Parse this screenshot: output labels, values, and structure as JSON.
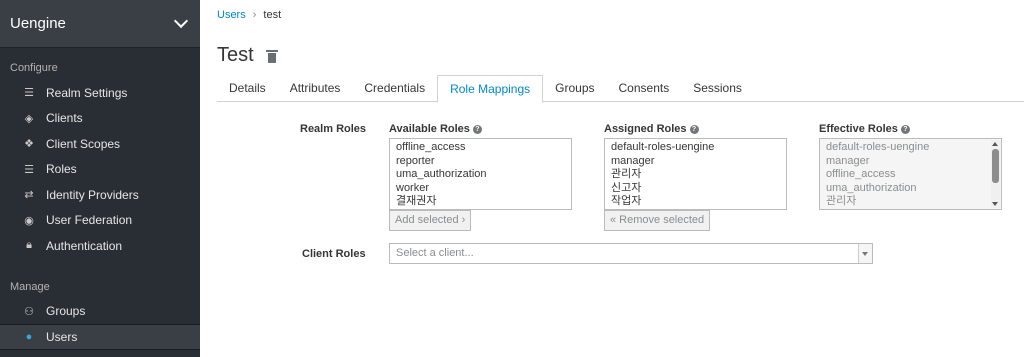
{
  "sidebar": {
    "realm": "Uengine",
    "configure_title": "Configure",
    "configure_items": [
      {
        "label": "Realm Settings",
        "icon": "sliders-icon"
      },
      {
        "label": "Clients",
        "icon": "cube-icon"
      },
      {
        "label": "Client Scopes",
        "icon": "cubes-icon"
      },
      {
        "label": "Roles",
        "icon": "list-icon"
      },
      {
        "label": "Identity Providers",
        "icon": "exchange-icon"
      },
      {
        "label": "User Federation",
        "icon": "database-icon"
      },
      {
        "label": "Authentication",
        "icon": "lock-icon"
      }
    ],
    "manage_title": "Manage",
    "manage_items": [
      {
        "label": "Groups",
        "icon": "users-icon"
      },
      {
        "label": "Users",
        "icon": "user-icon",
        "active": true
      }
    ]
  },
  "breadcrumb": {
    "parent": "Users",
    "current": "test"
  },
  "page_title": "Test",
  "tabs": [
    "Details",
    "Attributes",
    "Credentials",
    "Role Mappings",
    "Groups",
    "Consents",
    "Sessions"
  ],
  "active_tab": "Role Mappings",
  "realm_roles": {
    "label": "Realm Roles",
    "available": {
      "label": "Available Roles",
      "options": [
        "offline_access",
        "reporter",
        "uma_authorization",
        "worker",
        "결재권자"
      ],
      "button": "Add selected ›"
    },
    "assigned": {
      "label": "Assigned Roles",
      "options": [
        "default-roles-uengine",
        "manager",
        "관리자",
        "신고자",
        "작업자"
      ],
      "button": "« Remove selected"
    },
    "effective": {
      "label": "Effective Roles",
      "options": [
        "default-roles-uengine",
        "manager",
        "offline_access",
        "uma_authorization",
        "관리자"
      ]
    }
  },
  "client_roles": {
    "label": "Client Roles",
    "placeholder": "Select a client..."
  },
  "colors": {
    "sidebar_bg": "#292e34",
    "accent": "#0088ce",
    "active_icon": "#39a5dc"
  }
}
